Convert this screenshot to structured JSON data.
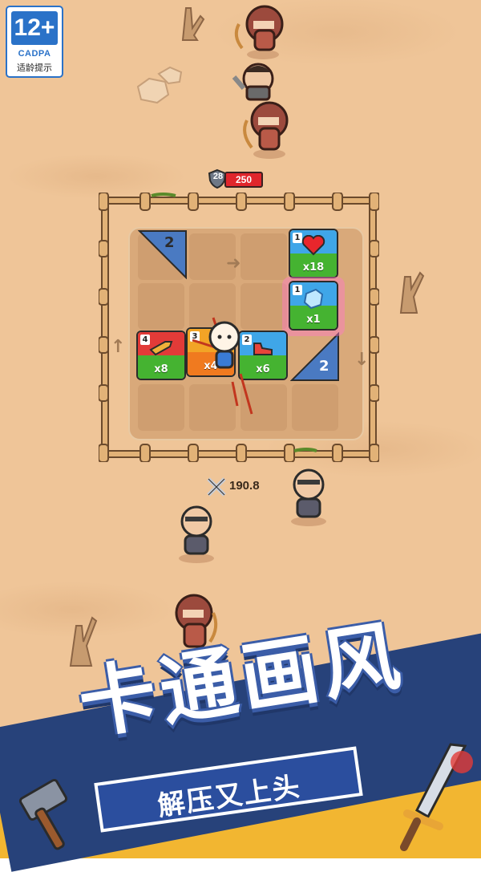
{
  "age_rating": {
    "value": "12+",
    "org": "CADPA",
    "tip": "适龄提示"
  },
  "enemy_hp": {
    "armor": "28",
    "hp": "250"
  },
  "board": {
    "cards": [
      {
        "id": "heart",
        "level": "1",
        "count": "x18",
        "icon": "heart-icon",
        "sky": "#3fa6e8"
      },
      {
        "id": "ice",
        "level": "1",
        "count": "x1",
        "icon": "ice-cube-icon",
        "sky": "#3fa6e8",
        "selected": true
      },
      {
        "id": "bullet",
        "level": "4",
        "count": "x8",
        "icon": "bullet-icon",
        "sky": "#e23b38"
      },
      {
        "id": "hero",
        "level": "3",
        "count": "x4",
        "icon": "arrows-icon",
        "sky": "#f2a426"
      },
      {
        "id": "speed",
        "level": "2",
        "count": "x6",
        "icon": "shoe-icon",
        "sky": "#3fa6e8"
      }
    ],
    "corner_tiles": [
      {
        "id": "top-left",
        "value": "2",
        "color": "#4a7ac2"
      },
      {
        "id": "right",
        "value": "2",
        "color": "#4a7ac2"
      }
    ]
  },
  "attack_power": "190.8",
  "banner": {
    "title": "卡通画风",
    "subtitle": "解压又上头"
  },
  "colors": {
    "sand": "#efc598",
    "banner_blue": "#2b4e9e",
    "banner_yellow": "#f2b631",
    "hp_red": "#e0262c"
  }
}
